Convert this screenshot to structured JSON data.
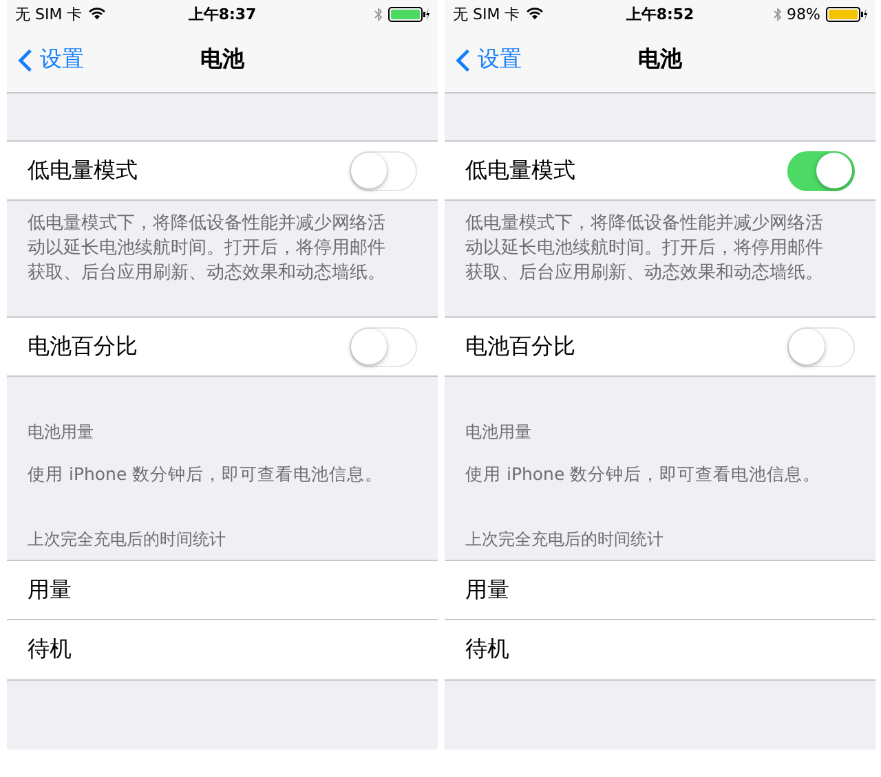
{
  "phones": [
    {
      "status_bar": {
        "carrier": "无 SIM 卡",
        "time": "上午8:37",
        "charging": true
      },
      "nav": {
        "back": "设置",
        "title": "电池"
      },
      "low_power": {
        "label": "低电量模式",
        "on": false
      },
      "low_power_note": "低电量模式下，将降低设备性能并减少网络活动以延长电池续航时间。打开后，将停用邮件获取、后台应用刷新、动态效果和动态墙纸。",
      "percentage": {
        "label": "电池百分比",
        "on": false
      },
      "usage_header": "电池用量",
      "usage_note": "使用 iPhone 数分钟后，即可查看电池信息。",
      "stats_header": "上次完全充电后的时间统计",
      "stats": [
        "用量",
        "待机"
      ]
    },
    {
      "status_bar": {
        "carrier": "无 SIM 卡",
        "time": "上午8:52",
        "battery_text": "98%",
        "charging": true
      },
      "nav": {
        "back": "设置",
        "title": "电池"
      },
      "low_power": {
        "label": "低电量模式",
        "on": true
      },
      "low_power_note": "低电量模式下，将降低设备性能并减少网络活动以延长电池续航时间。打开后，将停用邮件获取、后台应用刷新、动态效果和动态墙纸。",
      "percentage": {
        "label": "电池百分比",
        "on": false
      },
      "usage_header": "电池用量",
      "usage_note": "使用 iPhone 数分钟后，即可查看电池信息。",
      "stats_header": "上次完全充电后的时间统计",
      "stats": [
        "用量",
        "待机"
      ]
    }
  ]
}
